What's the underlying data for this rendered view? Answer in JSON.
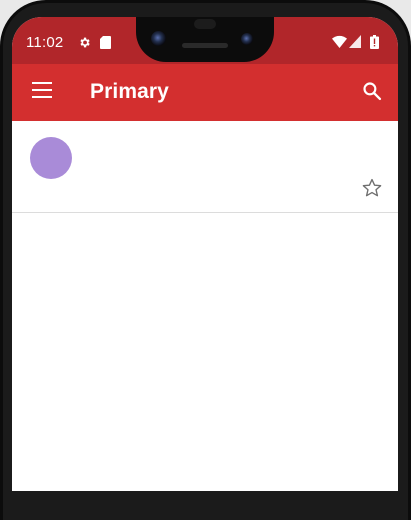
{
  "status_bar": {
    "time": "11:02",
    "icons": [
      "gear-icon",
      "sd-card-icon",
      "wifi-icon",
      "signal-icon",
      "battery-icon"
    ]
  },
  "app_bar": {
    "title": "Primary",
    "icons": [
      "menu-icon",
      "search-icon"
    ]
  },
  "list": {
    "items": [
      {
        "avatar_color": "#a98bd8",
        "starred": false
      }
    ]
  },
  "colors": {
    "status_bar": "#b1262a",
    "app_bar": "#d32f2f",
    "avatar": "#a98bd8",
    "background": "#ffffff"
  }
}
